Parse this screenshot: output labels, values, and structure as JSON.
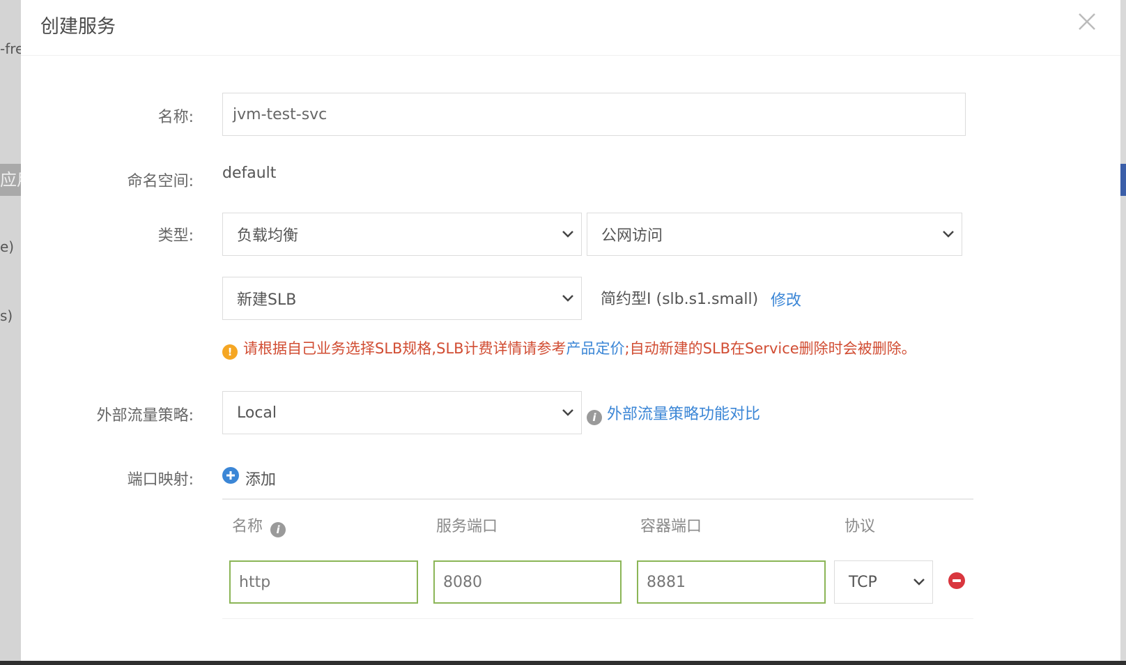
{
  "background": {
    "fragment_top": "-fre",
    "fragment_tab": "应用",
    "fragment_mid1": "e)",
    "fragment_mid2": "s)"
  },
  "modal": {
    "title": "创建服务"
  },
  "form": {
    "name": {
      "label": "名称:",
      "value": "jvm-test-svc"
    },
    "namespace": {
      "label": "命名空间:",
      "value": "default"
    },
    "type": {
      "label": "类型:",
      "service_type": "负载均衡",
      "access_type": "公网访问",
      "slb_option": "新建SLB",
      "slb_spec": "简约型I (slb.s1.small)",
      "modify_link": "修改"
    },
    "warning": {
      "part1": "请根据自己业务选择SLB规格,SLB计费详情请参考",
      "link": "产品定价",
      "part2": ";自动新建的SLB在Service删除时会被删除。"
    },
    "traffic_policy": {
      "label": "外部流量策略:",
      "value": "Local",
      "compare_link": "外部流量策略功能对比"
    },
    "port_mapping": {
      "label": "端口映射:",
      "add_label": "添加",
      "columns": [
        "名称",
        "服务端口",
        "容器端口",
        "协议"
      ],
      "rows": [
        {
          "name": "http",
          "service_port": "8080",
          "container_port": "8881",
          "protocol": "TCP"
        }
      ]
    }
  },
  "colors": {
    "link": "#3b86d6",
    "warning_text": "#d14d33",
    "valid_border": "#8bb556",
    "remove": "#d9363e"
  }
}
